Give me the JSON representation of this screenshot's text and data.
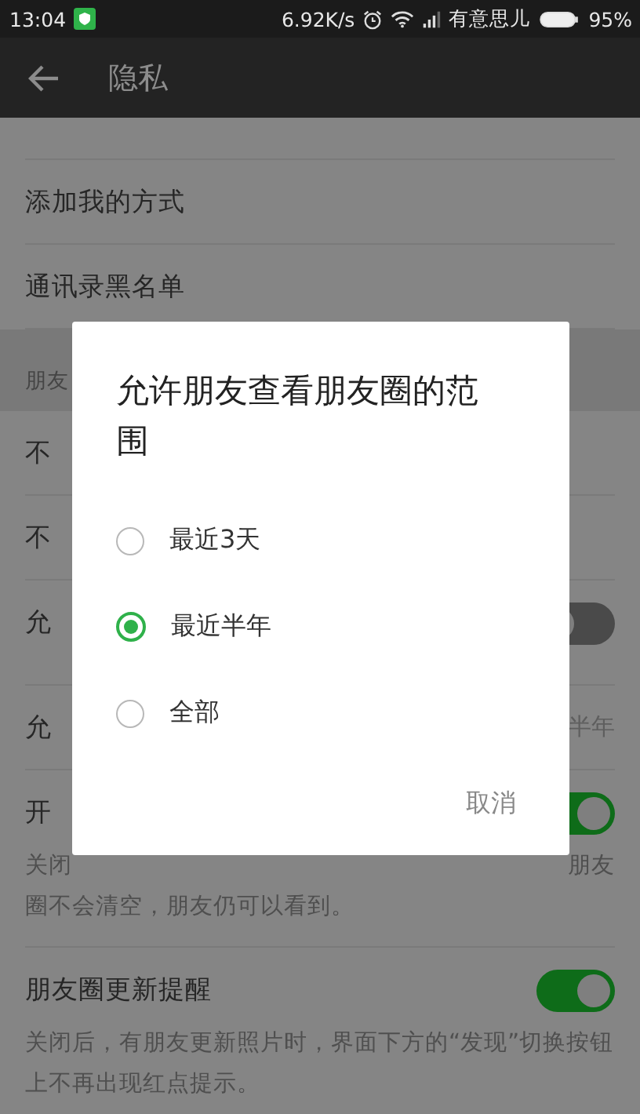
{
  "status_bar": {
    "time": "13:04",
    "speed": "6.92K/s",
    "carrier": "有意思儿",
    "battery": "95%"
  },
  "header": {
    "title": "隐私"
  },
  "items": [
    {
      "kind": "note"
    },
    {
      "kind": "row",
      "label": "添加我的方式"
    },
    {
      "kind": "row",
      "label": "通讯录黑名单"
    },
    {
      "kind": "section",
      "label": "朋友"
    },
    {
      "kind": "row",
      "label": "不"
    },
    {
      "kind": "row",
      "label": "不"
    },
    {
      "kind": "toggle",
      "label": "允",
      "on": false
    },
    {
      "kind": "row",
      "label": "允",
      "value": "半年"
    },
    {
      "kind": "toggle",
      "label": "开",
      "on": true,
      "description_start": "关闭",
      "description_end": "朋友",
      "description_more": "圈不会清空，朋友仍可以看到。"
    },
    {
      "kind": "toggle",
      "label": "朋友圈更新提醒",
      "on": true,
      "description": "关闭后，有朋友更新照片时，界面下方的“发现”切换按钮上不再出现红点提示。"
    }
  ],
  "dialog": {
    "title": "允许朋友查看朋友圈的范围",
    "options": [
      {
        "label": "最近3天",
        "selected": false
      },
      {
        "label": "最近半年",
        "selected": true
      },
      {
        "label": "全部",
        "selected": false
      }
    ],
    "cancel": "取消"
  }
}
